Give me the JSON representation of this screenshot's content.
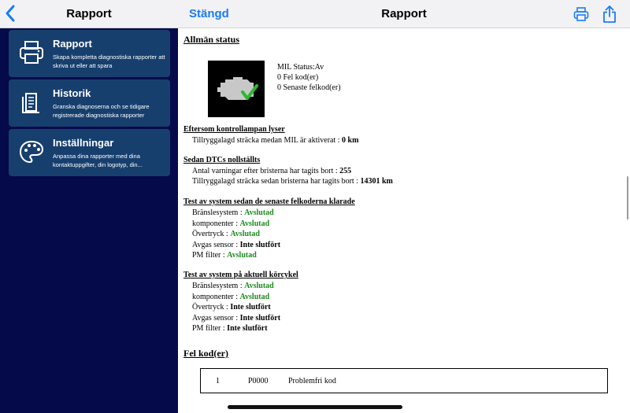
{
  "left_nav": {
    "title": "Rapport"
  },
  "menu": [
    {
      "title": "Rapport",
      "description": "Skapa kompletta diagnostiska rapporter att skriva ut eller att spara",
      "icon": "printer-icon"
    },
    {
      "title": "Historik",
      "description": "Granska diagnoserna och se tidigare registrerade diagnostiska rapporter",
      "icon": "history-icon"
    },
    {
      "title": "Inställningar",
      "description": "Anpassa dina rapporter med dina kontaktuppgifter, din logotyp, din...",
      "icon": "palette-icon"
    }
  ],
  "right_nav": {
    "done_label": "Stängd",
    "title": "Rapport"
  },
  "report": {
    "general_status": {
      "heading": "Allmän status",
      "mil_status": "MIL Status:Av",
      "fault_codes": "0 Fel kod(er)",
      "last_fault_codes": "0 Senaste felkod(er)"
    },
    "since_mil": {
      "heading": "Eftersom kontrollampan lyser",
      "distance_label": "Tillryggalagd sträcka medan MIL är aktiverat : ",
      "distance_value": "0 km"
    },
    "since_dtc_cleared": {
      "heading": "Sedan DTCs nollställts",
      "warmups_label": "Antal varningar efter bristerna har tagits bort : ",
      "warmups_value": "255",
      "distance_label": "Tillryggalagd sträcka sedan bristerna har tagits bort : ",
      "distance_value": "14301 km"
    },
    "tests_since_clear": {
      "heading": "Test av system sedan de senaste felkoderna klarade",
      "rows": [
        {
          "label": "Bränslesystem : ",
          "value": "Avslutad",
          "status": "ok"
        },
        {
          "label": "komponenter : ",
          "value": "Avslutad",
          "status": "ok"
        },
        {
          "label": "Övertryck : ",
          "value": "Avslutad",
          "status": "ok"
        },
        {
          "label": "Avgas sensor : ",
          "value": "Inte slutfört",
          "status": "pending"
        },
        {
          "label": "PM filter : ",
          "value": "Avslutad",
          "status": "ok"
        }
      ]
    },
    "tests_current_cycle": {
      "heading": "Test av system på aktuell körcykel",
      "rows": [
        {
          "label": "Bränslesystem : ",
          "value": "Avslutad",
          "status": "ok"
        },
        {
          "label": "komponenter : ",
          "value": "Avslutad",
          "status": "ok"
        },
        {
          "label": "Övertryck : ",
          "value": "Inte slutfört",
          "status": "pending"
        },
        {
          "label": "Avgas sensor : ",
          "value": "Inte slutfört",
          "status": "pending"
        },
        {
          "label": "PM filter : ",
          "value": "Inte slutfört",
          "status": "pending"
        }
      ]
    },
    "fault_codes": {
      "heading": "Fel kod(er)",
      "rows": [
        {
          "index": "1",
          "code": "P0000",
          "description": "Problemfri kod"
        }
      ]
    }
  },
  "colors": {
    "ok": "#1e8a1e",
    "accent": "#1a7cf0",
    "sidebar_bg": "#050a4a",
    "card_bg": "#173f6e"
  }
}
